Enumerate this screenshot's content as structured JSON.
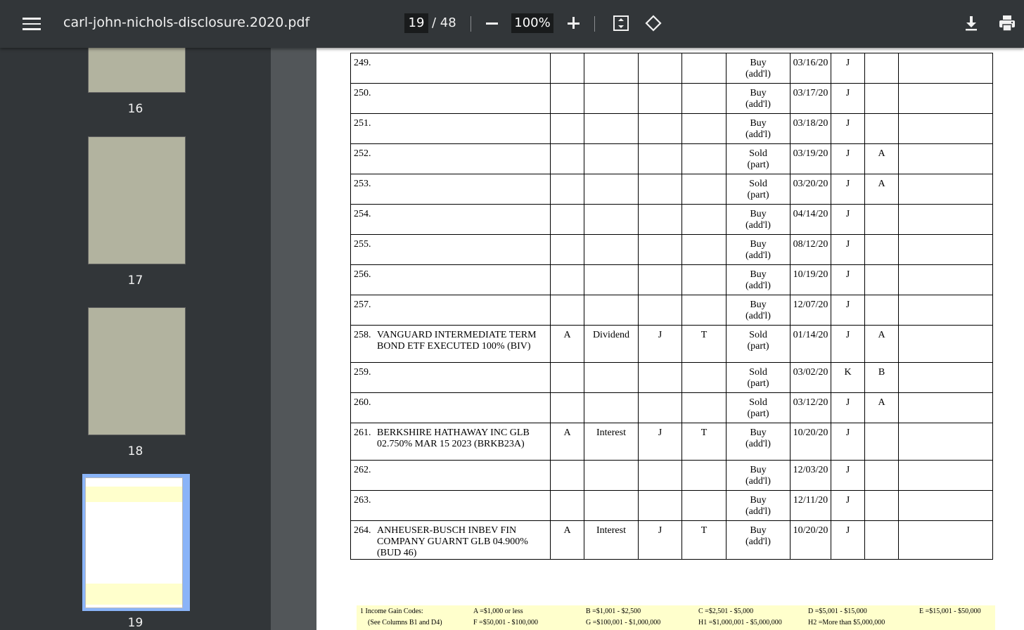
{
  "toolbar": {
    "title": "carl-john-nichols-disclosure.2020.pdf",
    "current_page": "19",
    "total_pages": "/ 48",
    "zoom": "100%"
  },
  "thumbnails": [
    {
      "label": "16"
    },
    {
      "label": "17"
    },
    {
      "label": "18"
    },
    {
      "label": "19"
    }
  ],
  "rows": [
    {
      "num": "249.",
      "desc": "",
      "b1": "",
      "b2": "",
      "b3": "",
      "b4": "",
      "type": "Buy\n(add'l)",
      "date": "03/16/20",
      "value": "J",
      "gain": ""
    },
    {
      "num": "250.",
      "desc": "",
      "b1": "",
      "b2": "",
      "b3": "",
      "b4": "",
      "type": "Buy\n(add'l)",
      "date": "03/17/20",
      "value": "J",
      "gain": ""
    },
    {
      "num": "251.",
      "desc": "",
      "b1": "",
      "b2": "",
      "b3": "",
      "b4": "",
      "type": "Buy\n(add'l)",
      "date": "03/18/20",
      "value": "J",
      "gain": ""
    },
    {
      "num": "252.",
      "desc": "",
      "b1": "",
      "b2": "",
      "b3": "",
      "b4": "",
      "type": "Sold\n(part)",
      "date": "03/19/20",
      "value": "J",
      "gain": "A"
    },
    {
      "num": "253.",
      "desc": "",
      "b1": "",
      "b2": "",
      "b3": "",
      "b4": "",
      "type": "Sold\n(part)",
      "date": "03/20/20",
      "value": "J",
      "gain": "A"
    },
    {
      "num": "254.",
      "desc": "",
      "b1": "",
      "b2": "",
      "b3": "",
      "b4": "",
      "type": "Buy\n(add'l)",
      "date": "04/14/20",
      "value": "J",
      "gain": ""
    },
    {
      "num": "255.",
      "desc": "",
      "b1": "",
      "b2": "",
      "b3": "",
      "b4": "",
      "type": "Buy\n(add'l)",
      "date": "08/12/20",
      "value": "J",
      "gain": ""
    },
    {
      "num": "256.",
      "desc": "",
      "b1": "",
      "b2": "",
      "b3": "",
      "b4": "",
      "type": "Buy\n(add'l)",
      "date": "10/19/20",
      "value": "J",
      "gain": ""
    },
    {
      "num": "257.",
      "desc": "",
      "b1": "",
      "b2": "",
      "b3": "",
      "b4": "",
      "type": "Buy\n(add'l)",
      "date": "12/07/20",
      "value": "J",
      "gain": ""
    },
    {
      "num": "258.",
      "desc": "VANGUARD INTERMEDIATE TERM BOND ETF EXECUTED 100% (BIV)",
      "b1": "A",
      "b2": "Dividend",
      "b3": "J",
      "b4": "T",
      "type": "Sold\n(part)",
      "date": "01/14/20",
      "value": "J",
      "gain": "A"
    },
    {
      "num": "259.",
      "desc": "",
      "b1": "",
      "b2": "",
      "b3": "",
      "b4": "",
      "type": "Sold\n(part)",
      "date": "03/02/20",
      "value": "K",
      "gain": "B"
    },
    {
      "num": "260.",
      "desc": "",
      "b1": "",
      "b2": "",
      "b3": "",
      "b4": "",
      "type": "Sold\n(part)",
      "date": "03/12/20",
      "value": "J",
      "gain": "A"
    },
    {
      "num": "261.",
      "desc": "BERKSHIRE HATHAWAY INC GLB 02.750% MAR 15 2023 (BRKB23A)",
      "b1": "A",
      "b2": "Interest",
      "b3": "J",
      "b4": "T",
      "type": "Buy\n(add'l)",
      "date": "10/20/20",
      "value": "J",
      "gain": ""
    },
    {
      "num": "262.",
      "desc": "",
      "b1": "",
      "b2": "",
      "b3": "",
      "b4": "",
      "type": "Buy\n(add'l)",
      "date": "12/03/20",
      "value": "J",
      "gain": ""
    },
    {
      "num": "263.",
      "desc": "",
      "b1": "",
      "b2": "",
      "b3": "",
      "b4": "",
      "type": "Buy\n(add'l)",
      "date": "12/11/20",
      "value": "J",
      "gain": ""
    },
    {
      "num": "264.",
      "desc": "ANHEUSER-BUSCH INBEV FIN COMPANY GUARNT GLB 04.900% (BUD 46)",
      "b1": "A",
      "b2": "Interest",
      "b3": "J",
      "b4": "T",
      "type": "Buy\n(add'l)",
      "date": "10/20/20",
      "value": "J",
      "gain": ""
    }
  ],
  "footer": {
    "heading": "1  Income Gain Codes:",
    "subheading": "(See Columns B1 and D4)",
    "codes": [
      "A =$1,000 or less",
      "B =$1,001 - $2,500",
      "C =$2,501 - $5,000",
      "D =$5,001 - $15,000",
      "E =$15,001 - $50,000",
      "F =$50,001 - $100,000",
      "G =$100,001 - $1,000,000",
      "H1 =$1,000,001 - $5,000,000",
      "H2 =More than $5,000,000"
    ]
  },
  "icons": {
    "menu": "hamburger-menu-icon",
    "fit": "fit-to-page-icon",
    "rotate": "rotate-counterclockwise-icon",
    "download": "download-icon",
    "print": "print-icon"
  }
}
